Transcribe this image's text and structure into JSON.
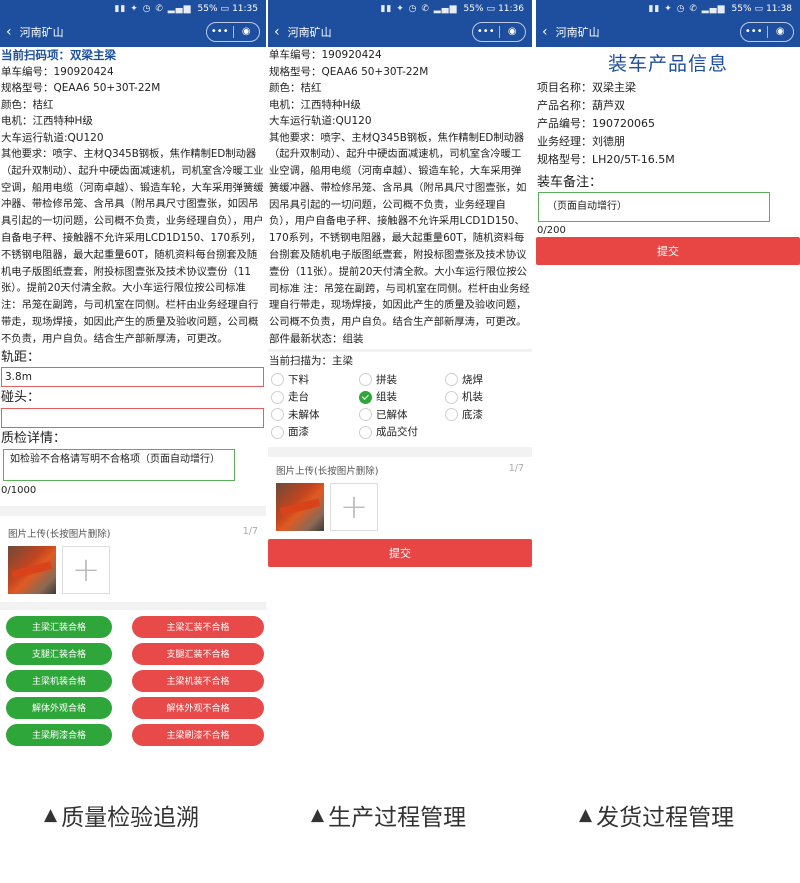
{
  "status": {
    "p1_time": "11:35",
    "p2_time": "11:36",
    "p3_time": "11:38",
    "battery": "55%"
  },
  "nav": {
    "title": "河南矿山",
    "back": "‹",
    "more": "•••",
    "target": "◉"
  },
  "panel1": {
    "scan_title": "当前扫码项：双梁主梁",
    "lines": [
      "单车编号：190920424",
      "规格型号：QEAA6 50+30T-22M",
      "颜色：桔红",
      "电机：江西特种H级",
      "大车运行轨道:QU120"
    ],
    "requirements": "其他要求：喷字、主材Q345B钢板，焦作精制ED制动器（起升双制动）、起升中硬齿面减速机，司机室含冷暖工业空调，船用电缆（河南卓越）、锻造车轮，大车采用弹簧缓冲器、带检修吊笼、含吊具（附吊具尺寸图壹张，如因吊具引起的一切问题，公司概不负责，业务经理自负），用户自备电子秤、接触器不允许采用LCD1D150、170系列，不锈钢电阻器，最大起重量60T，随机资料每台捌套及随机电子版图纸壹套，附投标图壹张及技术协议壹份（11张）。提前20天付清全款。大小车运行限位按公司标准 注：吊笼在副跨，与司机室在同侧。栏杆由业务经理自行带走，现场焊接，如因此产生的质量及验收问题，公司概不负责，用户自负。结合生产部新厚涛，可更改。",
    "gauge_label": "轨距：",
    "gauge_value": "3.8m",
    "buffer_label": "碰头：",
    "buffer_value": "",
    "quality_label": "质检详情：",
    "quality_placeholder": "如检验不合格请写明不合格项（页面自动增行）",
    "quality_counter": "0/1000",
    "upload_label": "图片上传(长按图片删除)",
    "upload_count": "1/7",
    "buttons_ok": [
      "主梁汇装合格",
      "支腿汇装合格",
      "主梁机装合格",
      "解体外观合格",
      "主梁刷漆合格"
    ],
    "buttons_fail": [
      "主梁汇装不合格",
      "支腿汇装不合格",
      "主梁机装不合格",
      "解体外观不合格",
      "主梁刷漆不合格"
    ]
  },
  "panel2": {
    "lines": [
      "单车编号：190920424",
      "规格型号：QEAA6 50+30T-22M",
      "颜色：桔红",
      "电机：江西特种H级",
      "大车运行轨道:QU120"
    ],
    "requirements": "其他要求：喷字、主材Q345B钢板，焦作精制ED制动器（起升双制动）、起升中硬齿面减速机，司机室含冷暖工业空调，船用电缆（河南卓越）、锻造车轮，大车采用弹簧缓冲器、带检修吊笼、含吊具（附吊具尺寸图壹张，如因吊具引起的一切问题，公司概不负责，业务经理自负），用户自备电子秤、接触器不允许采用LCD1D150、170系列，不锈钢电阻器，最大起重量60T，随机资料每台捌套及随机电子版图纸壹套，附投标图壹张及技术协议壹份（11张）。提前20天付清全款。大小车运行限位按公司标准 注：吊笼在副跨，与司机室在同侧。栏杆由业务经理自行带走，现场焊接，如因此产生的质量及验收问题，公司概不负责，用户自负。结合生产部新厚涛，可更改。",
    "latest_state": "部件最新状态：组装",
    "scan_current": "当前扫描为：主梁",
    "options": [
      {
        "label": "下料",
        "checked": false
      },
      {
        "label": "拼装",
        "checked": false
      },
      {
        "label": "烧焊",
        "checked": false
      },
      {
        "label": "走台",
        "checked": false
      },
      {
        "label": "组装",
        "checked": true
      },
      {
        "label": "机装",
        "checked": false
      },
      {
        "label": "未解体",
        "checked": false
      },
      {
        "label": "已解体",
        "checked": false
      },
      {
        "label": "底漆",
        "checked": false
      },
      {
        "label": "面漆",
        "checked": false
      },
      {
        "label": "成品交付",
        "checked": false
      }
    ],
    "upload_label": "图片上传(长按图片删除)",
    "upload_count": "1/7",
    "submit": "提交"
  },
  "panel3": {
    "title": "装车产品信息",
    "lines": [
      "项目名称：双梁主梁",
      "产品名称：葫芦双",
      "产品编号：190720065",
      "业务经理：刘德朋",
      "规格型号：LH20/5T-16.5M"
    ],
    "remark_label": "装车备注：",
    "remark_placeholder": "（页面自动增行）",
    "remark_counter": "0/200",
    "submit": "提交"
  },
  "captions": [
    "质量检验追溯",
    "生产过程管理",
    "发货过程管理"
  ],
  "caption_marker": "▲",
  "colors": {
    "nav": "#1d4f9e",
    "ok": "#2fa63a",
    "fail": "#e84a4a",
    "submit": "#e84545"
  }
}
